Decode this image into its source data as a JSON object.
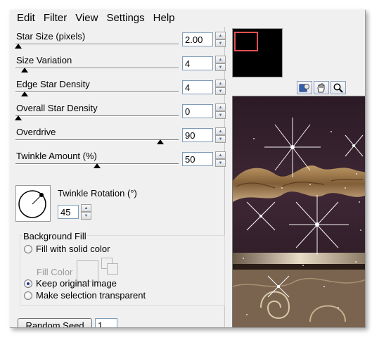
{
  "menu": [
    "Edit",
    "Filter",
    "View",
    "Settings",
    "Help"
  ],
  "params": [
    {
      "label": "Star Size (pixels)",
      "value": "2.00",
      "thumb_pct": 0.0
    },
    {
      "label": "Size Variation",
      "value": "4",
      "thumb_pct": 0.04
    },
    {
      "label": "Edge Star Density",
      "value": "4",
      "thumb_pct": 0.04
    },
    {
      "label": "Overall Star Density",
      "value": "0",
      "thumb_pct": 0.0
    },
    {
      "label": "Overdrive",
      "value": "90",
      "thumb_pct": 0.9
    },
    {
      "label": "Twinkle Amount (%)",
      "value": "50",
      "thumb_pct": 0.5
    }
  ],
  "rotation": {
    "label": "Twinkle Rotation (°)",
    "value": "45"
  },
  "background_fill": {
    "title": "Background Fill",
    "solid_label": "Fill with solid color",
    "fill_color_label": "Fill Color",
    "keep_label": "Keep original image",
    "transparent_label": "Make selection transparent",
    "selected": "keep"
  },
  "random_seed": {
    "label": "Random Seed",
    "value": "1"
  },
  "tools": [
    "navigate-icon",
    "hand-icon",
    "zoom-icon"
  ],
  "colors": {
    "accent": "#1c3f8c",
    "nav_rect": "#e05050"
  }
}
